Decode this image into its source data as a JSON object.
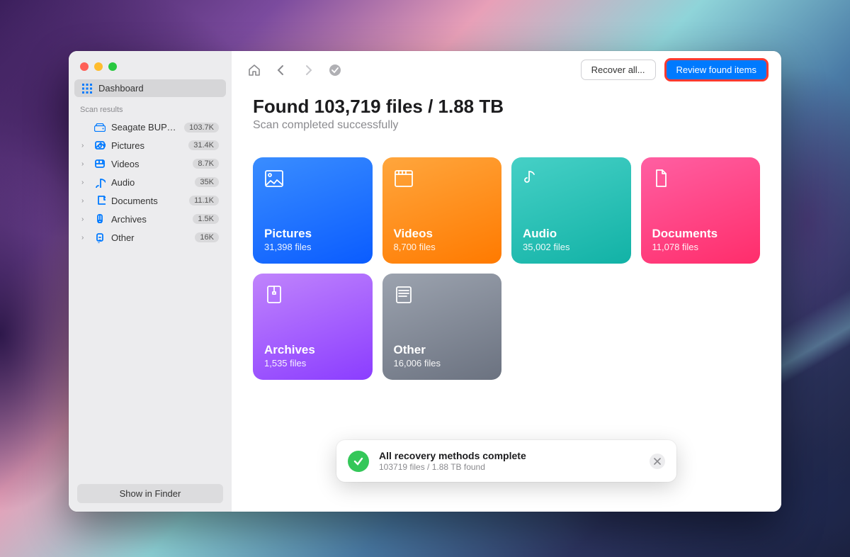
{
  "sidebar": {
    "dashboard_label": "Dashboard",
    "section_head": "Scan results",
    "disk": {
      "label": "Seagate BUP S...",
      "badge": "103.7K"
    },
    "items": [
      {
        "label": "Pictures",
        "badge": "31.4K",
        "icon": "pictures"
      },
      {
        "label": "Videos",
        "badge": "8.7K",
        "icon": "videos"
      },
      {
        "label": "Audio",
        "badge": "35K",
        "icon": "audio"
      },
      {
        "label": "Documents",
        "badge": "11.1K",
        "icon": "documents"
      },
      {
        "label": "Archives",
        "badge": "1.5K",
        "icon": "archives"
      },
      {
        "label": "Other",
        "badge": "16K",
        "icon": "other"
      }
    ],
    "finder_button": "Show in Finder"
  },
  "toolbar": {
    "recover_all_label": "Recover all...",
    "review_label": "Review found items"
  },
  "summary": {
    "headline": "Found 103,719 files / 1.88 TB",
    "subhead": "Scan completed successfully"
  },
  "tiles": [
    {
      "name": "Pictures",
      "count": "31,398 files",
      "class": "tile-pictures",
      "icon": "pictures"
    },
    {
      "name": "Videos",
      "count": "8,700 files",
      "class": "tile-videos",
      "icon": "videos"
    },
    {
      "name": "Audio",
      "count": "35,002 files",
      "class": "tile-audio",
      "icon": "audio"
    },
    {
      "name": "Documents",
      "count": "11,078 files",
      "class": "tile-documents",
      "icon": "documents"
    },
    {
      "name": "Archives",
      "count": "1,535 files",
      "class": "tile-archives",
      "icon": "archives"
    },
    {
      "name": "Other",
      "count": "16,006 files",
      "class": "tile-other",
      "icon": "other"
    }
  ],
  "toast": {
    "title": "All recovery methods complete",
    "subtitle": "103719 files / 1.88 TB found"
  },
  "colors": {
    "accent": "#007aff",
    "highlight": "#ff3b30"
  }
}
